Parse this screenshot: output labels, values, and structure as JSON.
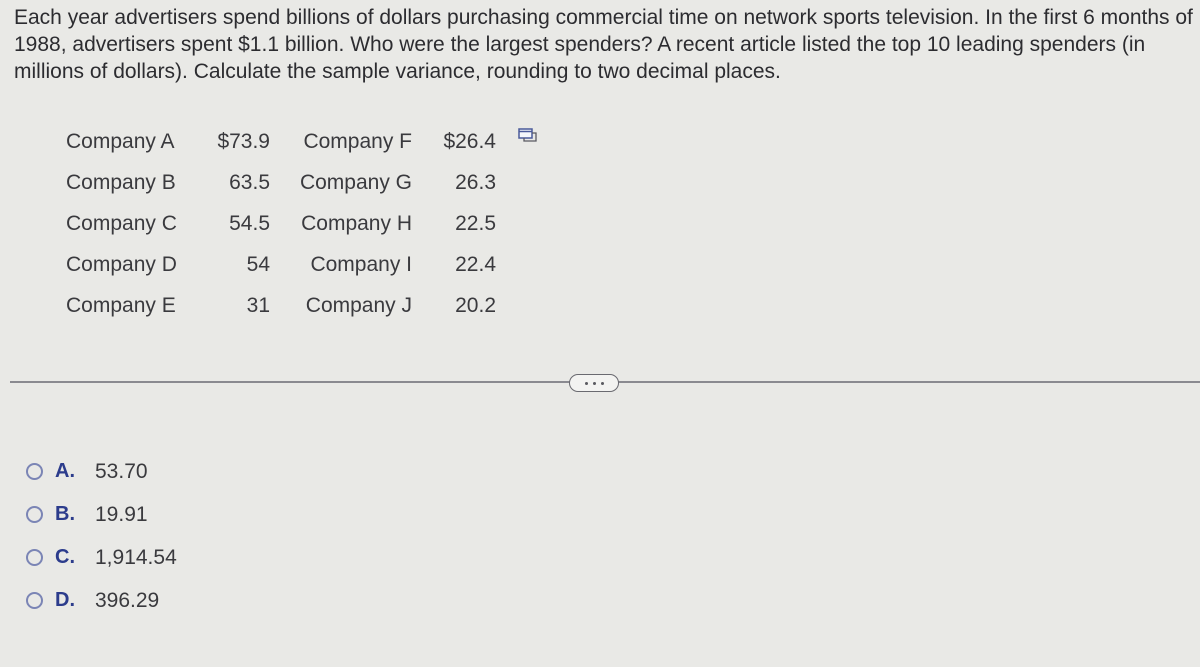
{
  "question": {
    "text": "Each year advertisers spend billions of dollars purchasing commercial time on network sports television. In the first 6 months of 1988, advertisers spent $1.1 billion. Who were the largest spenders? A recent article listed the top 10 leading spenders (in millions of dollars). Calculate the sample variance, rounding to two decimal places."
  },
  "table": {
    "rows": [
      {
        "name1": "Company A",
        "val1": "$73.9",
        "name2": "Company F",
        "val2": "$26.4"
      },
      {
        "name1": "Company B",
        "val1": "63.5",
        "name2": "Company G",
        "val2": "26.3"
      },
      {
        "name1": "Company C",
        "val1": "54.5",
        "name2": "Company H",
        "val2": "22.5"
      },
      {
        "name1": "Company D",
        "val1": "54",
        "name2": "Company I",
        "val2": "22.4"
      },
      {
        "name1": "Company E",
        "val1": "31",
        "name2": "Company J",
        "val2": "20.2"
      }
    ],
    "copy_icon": "copy-window-icon"
  },
  "more_button": {
    "icon": "ellipsis-icon"
  },
  "options": [
    {
      "letter": "A.",
      "value": "53.70"
    },
    {
      "letter": "B.",
      "value": "19.91"
    },
    {
      "letter": "C.",
      "value": "1,914.54"
    },
    {
      "letter": "D.",
      "value": "396.29"
    }
  ],
  "colors": {
    "background": "#e9e9e6",
    "text": "#2f2f33",
    "option_letter": "#2c3c8c",
    "radio_border": "#7b85b5",
    "divider": "#8a8a90"
  }
}
